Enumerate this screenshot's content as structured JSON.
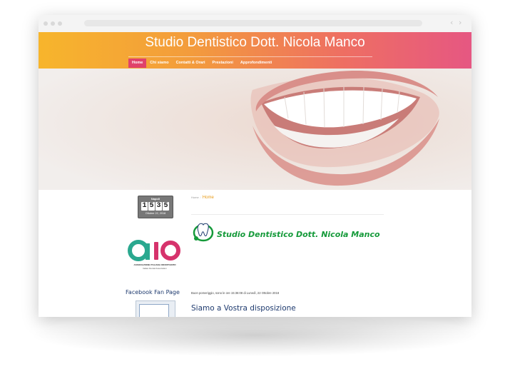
{
  "site": {
    "title": "Studio Dentistico Dott. Nicola Manco"
  },
  "nav": {
    "items": [
      {
        "label": "Home"
      },
      {
        "label": "Chi siamo"
      },
      {
        "label": "Contatti & Orari"
      },
      {
        "label": "Prestazioni"
      },
      {
        "label": "Approfondimenti"
      }
    ]
  },
  "counter": {
    "city": "Napoli",
    "digits": [
      "1",
      "5",
      "3",
      "5"
    ],
    "date": "Ottobre 22, 2018"
  },
  "aio": {
    "name": "ASSOCIAZIONE ITALIANA ODONTOIATRI",
    "subtitle": "Italian Dental Association"
  },
  "facebook": {
    "heading": "Facebook Fan Page"
  },
  "breadcrumb": {
    "root": "Home",
    "separator": "/",
    "current": "Home"
  },
  "logo": {
    "text": "Studio Dentistico Dott. Nicola Manco"
  },
  "greeting": "Buon pomeriggio, sono le ore 15:36:08 di Lunedì, 22 Ottobre 2018",
  "section": {
    "title": "Siamo a Vostra disposizione"
  },
  "colors": {
    "header_start": "#f7b52c",
    "header_end": "#e65782",
    "nav_active": "#e0426b",
    "brand_green": "#159a3a",
    "heading_blue": "#1e3a6e"
  }
}
